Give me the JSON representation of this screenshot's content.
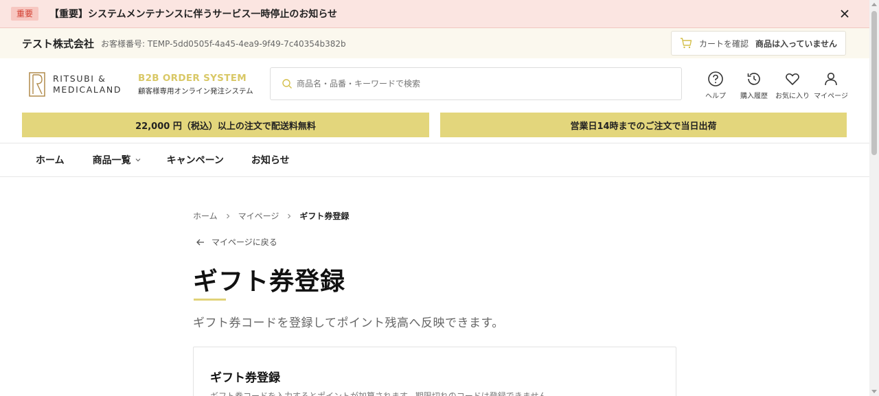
{
  "notice": {
    "badge": "重要",
    "message": "【重要】システムメンテナンスに伴うサービス一時停止のお知らせ",
    "close_icon": "close-icon"
  },
  "account": {
    "company": "テスト株式会社",
    "customer_no": "お客様番号: TEMP-5dd0505f-4a45-4ea9-9f49-7c40354b382b",
    "cart_label": "カートを確認",
    "cart_status": "商品は入っていません"
  },
  "brand": {
    "logo_line1": "RITSUBI &",
    "logo_line2": "MEDICALAND",
    "system_title": "B2B ORDER SYSTEM",
    "system_sub": "顧客様専用オンライン発注システム"
  },
  "search": {
    "placeholder": "商品名・品番・キーワードで検索"
  },
  "header_icons": [
    {
      "label": "ヘルプ",
      "icon": "help-icon"
    },
    {
      "label": "購入履歴",
      "icon": "history-icon"
    },
    {
      "label": "お気に入り",
      "icon": "heart-icon"
    },
    {
      "label": "マイページ",
      "icon": "user-icon"
    }
  ],
  "promo": {
    "left": "22,000 円（税込）以上の注文で配送料無料",
    "right": "営業日14時までのご注文で当日出荷"
  },
  "nav": {
    "items": [
      "ホーム",
      "商品一覧",
      "キャンペーン",
      "お知らせ"
    ]
  },
  "breadcrumb": {
    "items": [
      "ホーム",
      "マイページ",
      "ギフト券登録"
    ]
  },
  "back_link": "マイページに戻る",
  "page": {
    "title": "ギフト券登録",
    "lead": "ギフト券コードを登録してポイント残高へ反映できます。"
  },
  "card": {
    "title": "ギフト券登録",
    "description": "ギフト券コードを入力するとポイントが加算されます。期限切れのコードは登録できません。"
  },
  "colors": {
    "accent": "#e3d67c",
    "notice_bg": "#fbe5e1",
    "notice_badge": "#d23c2e",
    "system_title": "#d9c866"
  }
}
